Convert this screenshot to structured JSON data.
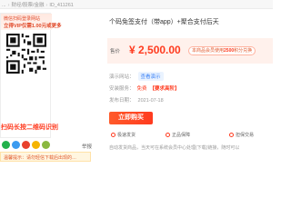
{
  "breadcrumb": [
    "...",
    "财经/股票/金融",
    "ID_411261"
  ],
  "promo": {
    "line1": "微信扫码登录网站",
    "line2": "立得VIP仅需1.00元或更多",
    "scan_text": "扫码长按二维码识别",
    "sub_text": ""
  },
  "share": {
    "report": "举报"
  },
  "notice": {
    "text": "温馨提示：请勿轻信下载后出现的…"
  },
  "product": {
    "title": "个码免签支付（带app）+聚合支付后天",
    "price_label": "售价",
    "price": "¥ 2,500.00",
    "vip_note_prefix": "本商品会员使用",
    "vip_note_amount": "2500",
    "vip_note_suffix": "积分兑换",
    "demo_label": "演示网站：",
    "demo_button": "查看演示",
    "install_label": "安装服务：",
    "install_free": "免费",
    "install_vip": "【要求高阶】",
    "date_label": "发布日期：",
    "date_value": "2021-07-18",
    "buy_button": "立即购买",
    "guarantees": [
      "极速发货",
      "正品保障",
      "担保交易"
    ],
    "footnote": "自动发货商品，当天可在系统会员中心处理(下载)链接，随时可以"
  },
  "colors": {
    "accent": "#ff3b1f",
    "link": "#3b82f6",
    "notice_bg": "#fff6e0"
  },
  "icons": {
    "share": [
      "wechat-icon",
      "qq-icon",
      "weibo-icon",
      "qzone-icon",
      "link-icon"
    ]
  }
}
